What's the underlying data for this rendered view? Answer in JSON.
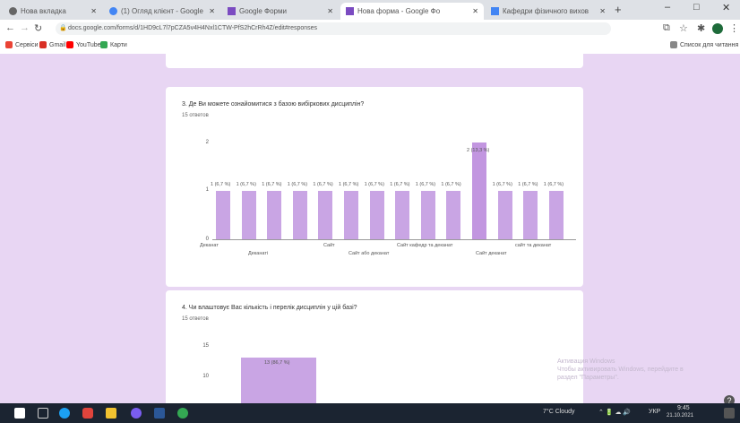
{
  "browser": {
    "tabs": [
      {
        "label": "Нова вкладка"
      },
      {
        "label": "(1) Огляд клієнт - Google"
      },
      {
        "label": "Google Форми"
      },
      {
        "label": "Нова форма - Google Фо"
      },
      {
        "label": "Кафедри фізичного вихов"
      }
    ],
    "new_tab": "+",
    "window": {
      "minimize": "–",
      "maximize": "□",
      "close": "✕"
    },
    "url": "docs.google.com/forms/d/1HD9cL7l7pCZA5v4H4Nxl1CTW-PfS2hCrRh4Z/edit#responses",
    "bookmarks": [
      "Сервіси",
      "Gmail",
      "YouTube",
      "Карти"
    ],
    "reading_list": "Список для читання"
  },
  "question3": {
    "title": "3. Де Ви можете ознайомитися з базою вибіркових дисциплін?",
    "count": "15 ответов",
    "y_ticks": [
      "2",
      "1",
      "0"
    ],
    "bar_labels": [
      "1 (6,7 %)",
      "1 (6,7 %)",
      "1 (6,7 %)",
      "1 (6,7 %)",
      "1 (6,7 %)",
      "1 (6,7 %)",
      "1 (6,7 %)",
      "1 (6,7 %)",
      "1 (6,7 %)",
      "1 (6,7 %)",
      "2 (13,3 %)",
      "1 (6,7 %)",
      "1 (6,7 %)",
      "1 (6,7 %)"
    ],
    "x_labels_row1": [
      "Деканат",
      "Сайт",
      "Сайт кафедр та деканат",
      "сайт та деканат"
    ],
    "x_labels_row2": [
      "Деканаті",
      "Сайт або деканат",
      "Сайт деканат"
    ]
  },
  "question4": {
    "title": "4. Чи влаштовує Вас кількість і перелік дисциплін у цій базі?",
    "count": "15 ответов",
    "y_ticks": [
      "15",
      "10"
    ],
    "bar_label": "13 (86,7 %)"
  },
  "chart_data": [
    {
      "type": "bar",
      "title": "3. Де Ви можете ознайомитися з базою вибіркових дисциплін?",
      "categories": [
        "Деканат",
        "Деканаті",
        "",
        "Сайт",
        "",
        "Сайт або деканат",
        "",
        "Сайт кафедр та деканат",
        "",
        "",
        "Сайт деканат",
        "",
        "сайт та деканат",
        ""
      ],
      "values": [
        1,
        1,
        1,
        1,
        1,
        1,
        1,
        1,
        1,
        1,
        2,
        1,
        1,
        1
      ],
      "ylim": [
        0,
        2
      ]
    },
    {
      "type": "bar",
      "title": "4. Чи влаштовує Вас кількість і перелік дисциплін у цій базі?",
      "categories": [
        ""
      ],
      "values": [
        13
      ],
      "ylim": [
        0,
        15
      ]
    }
  ],
  "watermark": {
    "line1": "Активация Windows",
    "line2": "Чтобы активировать Windows, перейдите в",
    "line3": "раздел \"Параметры\"."
  },
  "help": "?",
  "taskbar": {
    "weather": "7°C Cloudy",
    "lang": "УКР",
    "time": "9:45",
    "date": "21.10.2021"
  },
  "colors": {
    "accent": "#c9a5e4",
    "page_bg": "#e8d6f3",
    "taskbar": "#1b2431"
  }
}
